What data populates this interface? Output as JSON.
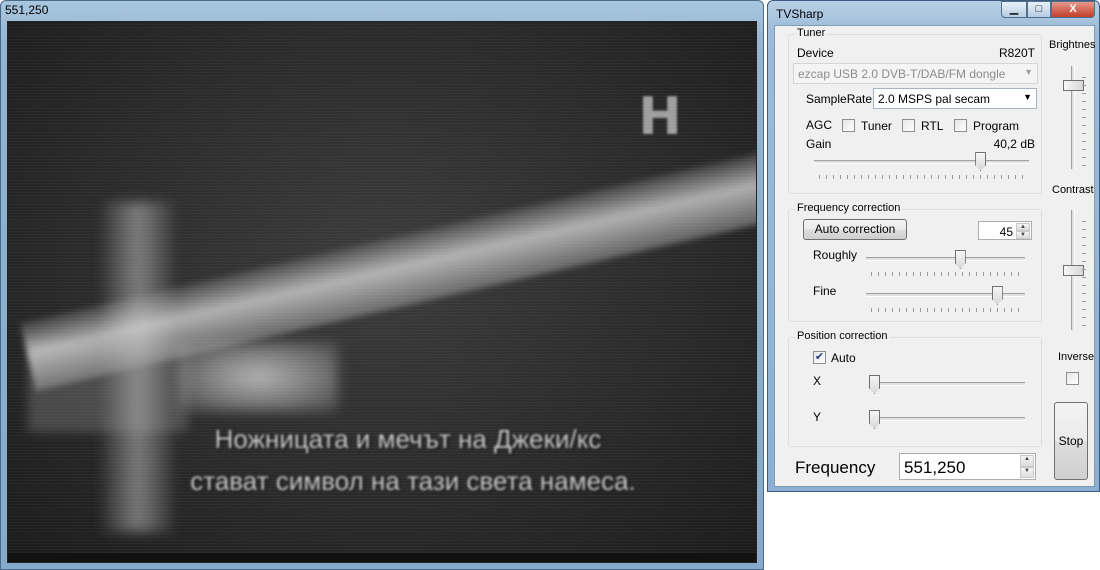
{
  "video_window": {
    "title": "551,250",
    "logo": "Н",
    "subtitle_line1": "Ножницата и мечът на Джеки/кс",
    "subtitle_line2": "стават символ на тази света намеса."
  },
  "tvsharp_window": {
    "title": "TVSharp",
    "close_glyph": "X",
    "minimize_glyph": "▁",
    "maximize_glyph": "□"
  },
  "tuner": {
    "group_label": "Tuner",
    "device_label": "Device",
    "device_model": "R820T",
    "device_value": "ezcap USB 2.0 DVB-T/DAB/FM dongle",
    "samplerate_label": "SampleRate",
    "samplerate_value": "2.0 MSPS pal secam",
    "agc_label": "AGC",
    "agc_tuner_label": "Tuner",
    "agc_rtl_label": "RTL",
    "agc_program_label": "Program",
    "agc_tuner_checked": false,
    "agc_rtl_checked": false,
    "agc_program_checked": false,
    "gain_label": "Gain",
    "gain_value": "40,2 dB",
    "gain_level": 0.79
  },
  "frequency_correction": {
    "group_label": "Frequency correction",
    "auto_correction_label": "Auto correction",
    "correction_value": "45",
    "roughly_label": "Roughly",
    "roughly_level": 0.6,
    "fine_label": "Fine",
    "fine_level": 0.85
  },
  "position_correction": {
    "group_label": "Position correction",
    "auto_label": "Auto",
    "auto_checked": true,
    "x_label": "X",
    "x_level": 0.0,
    "y_label": "Y",
    "y_level": 0.0
  },
  "right_panel": {
    "brightness_label": "Brightnes",
    "brightness_level": 0.85,
    "contrast_label": "Contrast",
    "contrast_level": 0.5,
    "inverse_label": "Inverse",
    "inverse_checked": false,
    "stop_label": "Stop"
  },
  "frequency": {
    "label": "Frequency",
    "value": "551,250"
  },
  "icons": {
    "dropdown": "chevron-down-icon",
    "check": "checkmark-icon",
    "spin_up": "arrow-up-icon",
    "spin_down": "arrow-down-icon"
  }
}
